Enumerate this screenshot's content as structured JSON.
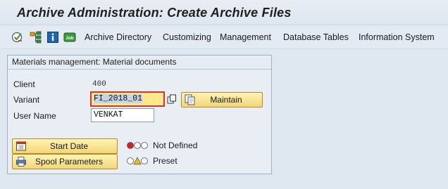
{
  "title": "Archive Administration: Create Archive Files",
  "toolbar": {
    "icons": [
      "execute-check-icon",
      "hierarchy-icon",
      "info-icon",
      "job-icon"
    ],
    "job_icon_text": "Job",
    "menu": [
      "Archive Directory",
      "Customizing",
      "Management",
      "Database Tables",
      "Information System"
    ]
  },
  "group": {
    "title": "Materials management: Material documents",
    "client_label": "Client",
    "client_value": "400",
    "variant_label": "Variant",
    "variant_value": "FI_2018_01",
    "maintain_label": "Maintain",
    "username_label": "User Name",
    "username_value": "VENKAT",
    "start_date_label": "Start Date",
    "spool_label": "Spool Parameters",
    "start_status": "Not Defined",
    "spool_status": "Preset"
  },
  "colors": {
    "title_bar": "#dde5ef",
    "work_area": "#dfe7f1",
    "button_fill": "#f3d675",
    "focus_outline": "#d8342a",
    "light_red": "#d42222",
    "light_yellow": "#f2c200",
    "light_green": "#1fa12e"
  }
}
